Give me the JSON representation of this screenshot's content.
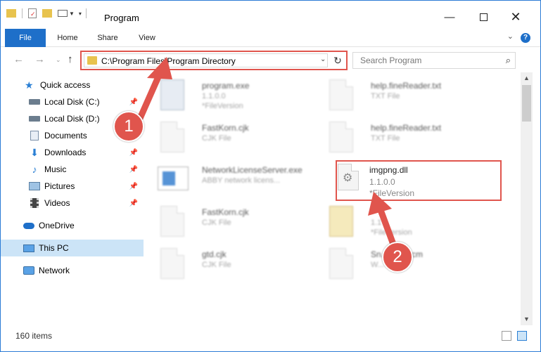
{
  "window": {
    "title": "Program"
  },
  "ribbon": {
    "tabs": [
      "File",
      "Home",
      "Share",
      "View"
    ]
  },
  "address": {
    "path": "C:\\Program Files\\Program Directory"
  },
  "search": {
    "placeholder": "Search Program"
  },
  "sidebar": {
    "items": [
      {
        "label": "Quick access"
      },
      {
        "label": "Local Disk (C:)"
      },
      {
        "label": "Local Disk (D:)"
      },
      {
        "label": "Documents"
      },
      {
        "label": "Downloads"
      },
      {
        "label": "Music"
      },
      {
        "label": "Pictures"
      },
      {
        "label": "Videos"
      },
      {
        "label": "OneDrive"
      },
      {
        "label": "This PC"
      },
      {
        "label": "Network"
      }
    ]
  },
  "files": [
    {
      "name": "program.exe",
      "line2": "1.1.0.0",
      "line3": "*FileVersion"
    },
    {
      "name": "help.fineReader.txt",
      "line2": "TXT File",
      "line3": ""
    },
    {
      "name": "FastKorn.cjk",
      "line2": "CJK File",
      "line3": ""
    },
    {
      "name": "help.fineReader.txt",
      "line2": "TXT File",
      "line3": ""
    },
    {
      "name": "NetworkLicenseServer.exe",
      "line2": "ABBY network licens...",
      "line3": ""
    },
    {
      "name": "imgpng.dll",
      "line2": "1.1.0.0",
      "line3": "*FileVersion"
    },
    {
      "name": "FastKorn.cjk",
      "line2": "CJK File",
      "line3": ""
    },
    {
      "name": "",
      "line2": "1.1",
      "line3": "*FileVersion"
    },
    {
      "name": "gtd.cjk",
      "line2": "CJK File",
      "line3": ""
    },
    {
      "name": "Sn...P12.wcm",
      "line2": "W...",
      "line3": ""
    }
  ],
  "status": {
    "count": "160 items"
  },
  "callouts": {
    "first": "1",
    "second": "2"
  },
  "colors": {
    "accent": "#1e6fc9",
    "highlight": "#e0554d",
    "selection": "#cce4f7"
  }
}
